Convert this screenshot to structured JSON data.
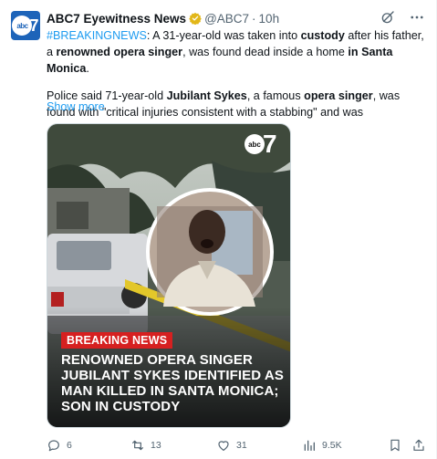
{
  "account": {
    "display_name": "ABC7 Eyewitness News",
    "handle": "@ABC7",
    "separator": "·",
    "time": "10h",
    "avatar_text": "abc",
    "avatar_number": "7"
  },
  "post": {
    "hashtag": "#BREAKINGNEWS",
    "p1_a": ": A 31-year-old was taken into ",
    "p1_b": "custody",
    "p1_c": " after his father, a ",
    "p1_d": "renowned opera singer",
    "p1_e": ", was found dead inside a home ",
    "p1_f": "in Santa Monica",
    "p1_g": ".",
    "p2_a": "Police said 71-year-old ",
    "p2_b": "Jubilant Sykes",
    "p2_c": ", a famous ",
    "p2_d": "opera singer",
    "p2_e": ", was found with \"critical injuries consistent with a stabbing\" and was",
    "show_more": "Show more"
  },
  "media": {
    "logo_text": "abc",
    "logo_number": "7",
    "banner": "BREAKING NEWS",
    "headline": "RENOWNED OPERA SINGER JUBILANT SYKES IDENTIFIED AS MAN KILLED IN SANTA MONICA; SON IN CUSTODY"
  },
  "actions": {
    "replies": "6",
    "reposts": "13",
    "likes": "31",
    "views": "9.5K"
  },
  "colors": {
    "accent": "#1d9bf0",
    "verified": "#e2b719",
    "banner_red": "#d62020",
    "muted": "#536471"
  },
  "icons": [
    "verified-badge-icon",
    "grok-icon",
    "more-icon",
    "reply-icon",
    "repost-icon",
    "like-icon",
    "views-icon",
    "bookmark-icon",
    "share-icon"
  ]
}
